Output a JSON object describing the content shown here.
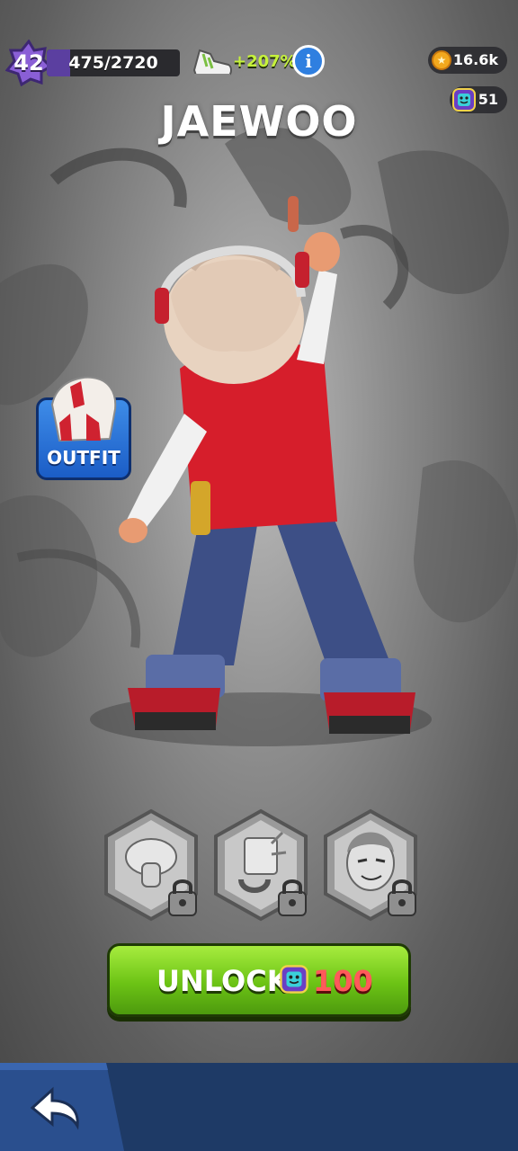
{
  "hud": {
    "level": "42",
    "xp_text": "475/2720",
    "xp_progress": 0.175,
    "boost_text": "+207%",
    "info_icon": "info-icon",
    "coins": "16.6k",
    "tokens": "51"
  },
  "character": {
    "name": "JAEWOO"
  },
  "outfit": {
    "label": "OUTFIT"
  },
  "locked_items": [
    {
      "icon": "mushroom-icon",
      "locked": true
    },
    {
      "icon": "gadget-icon",
      "locked": true
    },
    {
      "icon": "portrait-icon",
      "locked": true
    }
  ],
  "unlock": {
    "label": "UNLOCK",
    "price": "100"
  },
  "colors": {
    "accent_green": "#6cc315",
    "price_red": "#ff5a5a",
    "nav_blue": "#1e3a66",
    "boost_green": "#c6f23b"
  }
}
